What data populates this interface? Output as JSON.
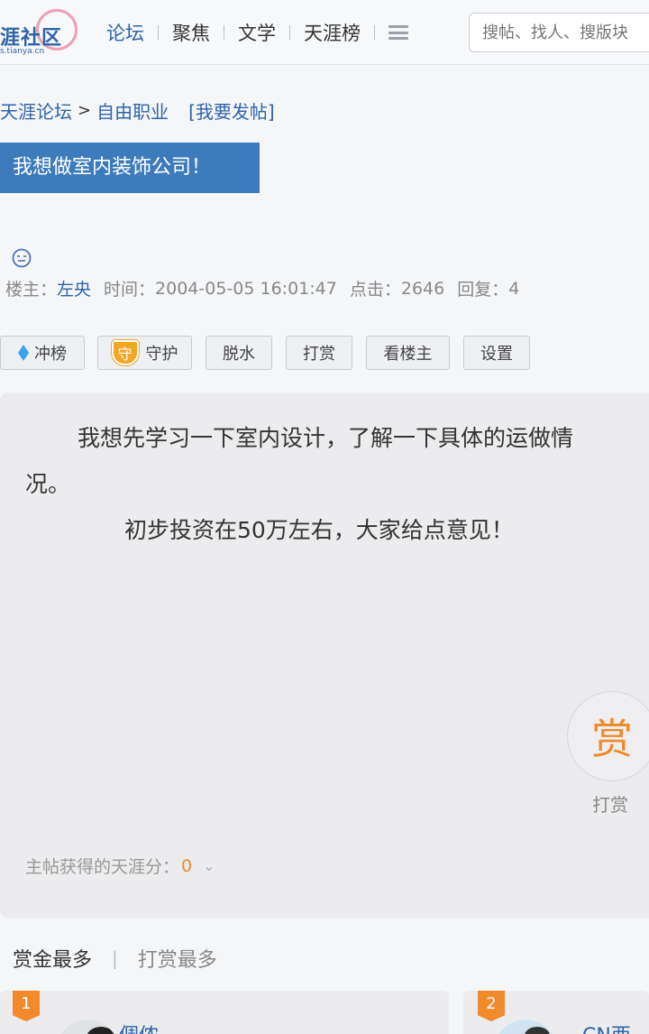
{
  "header": {
    "logo_text": "涯社区",
    "logo_sub": "s.tianya.cn",
    "nav": [
      "论坛",
      "聚焦",
      "文学",
      "天涯榜"
    ],
    "search_placeholder": "搜帖、找人、搜版块"
  },
  "breadcrumb": {
    "forum": "天涯论坛",
    "separator": ">",
    "board": "自由职业",
    "post_link": "[我要发帖]"
  },
  "post": {
    "title": "我想做室内装饰公司！",
    "meta": {
      "author_label": "楼主：",
      "author": "左央",
      "time_label": "时间：",
      "time": "2004-05-05 16:01:47",
      "clicks_label": "点击：",
      "clicks": "2646",
      "replies_label": "回复：",
      "replies": "4"
    },
    "actions": [
      "冲榜",
      "守护",
      "脱水",
      "打赏",
      "看楼主",
      "设置"
    ],
    "shield_char": "守",
    "body_line1": "我想先学习一下室内设计，了解一下具体的运做情",
    "body_line1b": "况。",
    "body_line2": "初步投资在50万左右，大家给点意见！",
    "reward_char": "赏",
    "reward_label": "打赏",
    "score_label": "主帖获得的天涯分：",
    "score_value": "0"
  },
  "ranking": {
    "tabs": [
      "赏金最多",
      "打赏最多"
    ],
    "entries": [
      {
        "rank": "1",
        "name": "倜侬"
      },
      {
        "rank": "2",
        "name": "CN西南"
      }
    ]
  },
  "colors": {
    "brand_blue": "#2e63a8",
    "title_bg": "#3e7bbd",
    "accent_orange": "#f08a2c"
  }
}
